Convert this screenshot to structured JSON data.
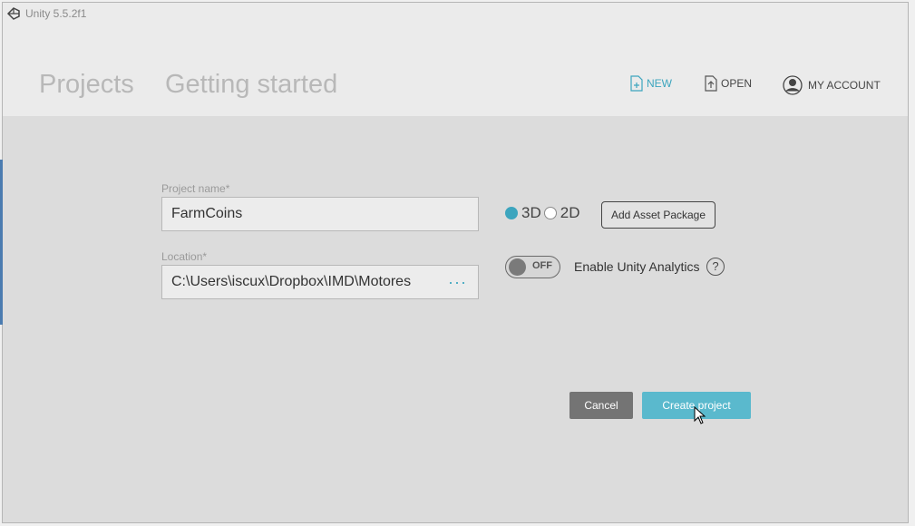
{
  "window": {
    "title": "Unity 5.5.2f1"
  },
  "nav": {
    "tabs": [
      {
        "label": "Projects"
      },
      {
        "label": "Getting started"
      }
    ]
  },
  "header_actions": {
    "new_label": "NEW",
    "open_label": "OPEN",
    "account_label": "MY ACCOUNT"
  },
  "form": {
    "project_name_label": "Project name*",
    "project_name_value": "FarmCoins",
    "location_label": "Location*",
    "location_value": "C:\\Users\\iscux\\Dropbox\\IMD\\Motores",
    "browse_dots": "···",
    "mode_3d": "3D",
    "mode_2d": "2D",
    "selected_mode": "3D",
    "add_asset_package": "Add Asset Package",
    "analytics_toggle_state": "OFF",
    "analytics_label": "Enable Unity Analytics",
    "help_glyph": "?"
  },
  "actions": {
    "cancel_label": "Cancel",
    "create_label": "Create project"
  },
  "colors": {
    "accent": "#3ca5be",
    "create_button": "#5ab9cd",
    "cancel_button": "#747474",
    "background": "#dcdcdc"
  }
}
